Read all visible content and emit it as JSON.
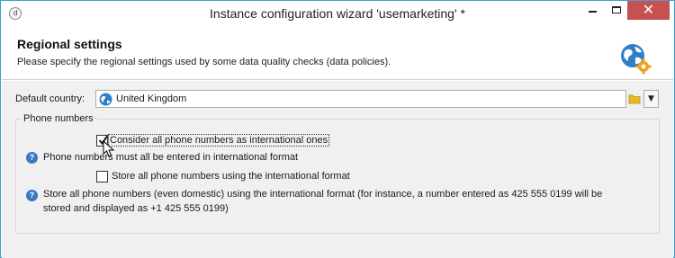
{
  "window": {
    "title": "Instance configuration wizard 'usemarketing' *",
    "app_icon_text": "d",
    "minimize_icon": "minimize-icon",
    "maximize_icon": "maximize-icon",
    "close_label": "✕"
  },
  "header": {
    "title": "Regional settings",
    "subtitle": "Please specify the regional settings used by some data quality checks (data policies).",
    "icon": "globe-gear-icon"
  },
  "default_country": {
    "label": "Default country:",
    "value": "United Kingdom",
    "icon": "globe-icon",
    "folder_icon": "folder-icon",
    "dropdown_glyph": "▼"
  },
  "phone_numbers": {
    "group_label": "Phone numbers",
    "options": [
      {
        "label": "Consider all phone numbers as international ones",
        "checked": true
      },
      {
        "label": "Store all phone numbers using the international format",
        "checked": false
      }
    ],
    "help": [
      {
        "glyph": "?",
        "text": "Phone numbers must all be entered in international format"
      },
      {
        "glyph": "?",
        "text_line1": "Store all phone numbers (even domestic) using the international format (for instance, a number entered as 425 555 0199 will be",
        "text_line2": "stored and displayed as +1 425 555 0199)"
      }
    ]
  },
  "colors": {
    "accent": "#3c9fd6",
    "close": "#c75050",
    "help": "#3b76c4",
    "folder": "#e8b923"
  }
}
